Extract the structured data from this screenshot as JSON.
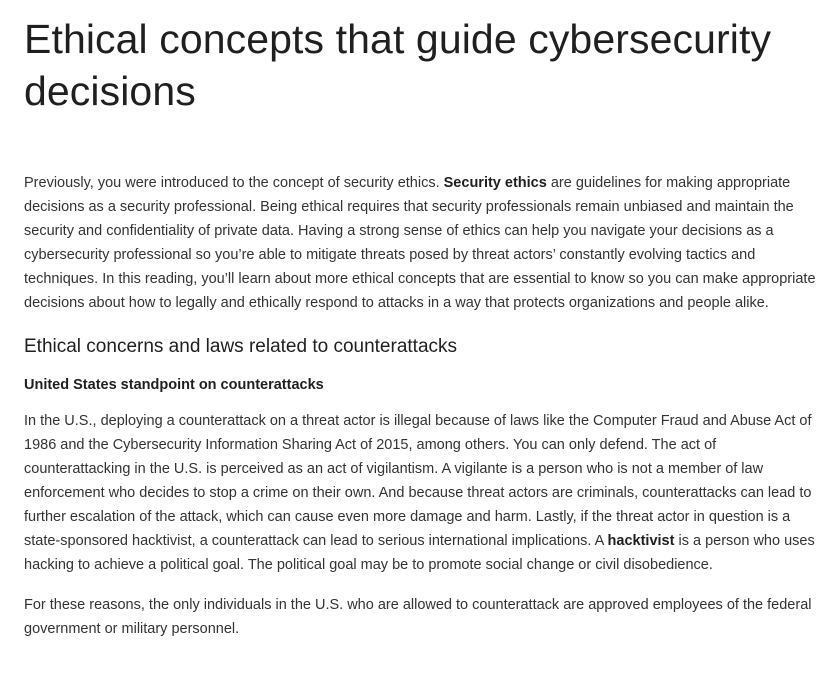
{
  "title": "Ethical concepts that guide cybersecurity decisions",
  "intro": {
    "pre": "Previously, you were introduced to the concept of security ethics. ",
    "term": "Security ethics",
    "post": " are guidelines for making appropriate decisions as a security professional. Being ethical requires that security professionals remain unbiased and maintain the security and confidentiality of private data. Having a strong sense of ethics can help you navigate your decisions as a cybersecurity professional so you’re able to mitigate threats posed by threat actors’ constantly evolving tactics and techniques. In this reading, you’ll learn about more ethical concepts that are essential to know so you can make appropriate decisions about how to legally and ethically respond to attacks in a way that protects organizations and people alike."
  },
  "section": {
    "heading": "Ethical concerns and laws related to counterattacks",
    "subheading": "United States standpoint on counterattacks",
    "para1": {
      "pre": "In the U.S., deploying a counterattack on a threat actor is illegal because of laws like the Computer Fraud and Abuse Act of 1986 and the Cybersecurity Information Sharing Act of 2015, among others. You can only defend. The act of counterattacking in the U.S. is perceived as an act of vigilantism. A vigilante is a person who is not a member of law enforcement who decides to stop a crime on their own. And because threat actors are criminals, counterattacks can lead to further escalation of the attack, which can cause even more damage and harm. Lastly, if the threat actor in question is a state-sponsored hacktivist, a counterattack can lead to serious international implications. A ",
      "term": "hacktivist",
      "post": " is a person who uses hacking to achieve a political goal. The political goal may be to promote social change or civil disobedience."
    },
    "para2": "For these reasons, the only individuals in the U.S. who are allowed to counterattack are approved employees of the federal government or military personnel."
  }
}
